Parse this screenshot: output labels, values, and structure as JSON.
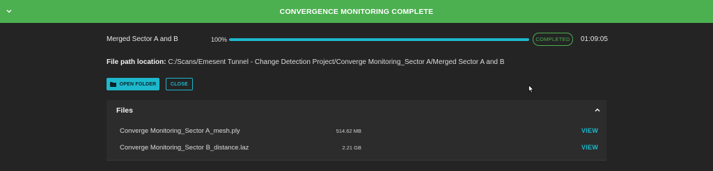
{
  "banner": {
    "title": "CONVERGENCE MONITORING COMPLETE",
    "chevron_icon": "chevron-down-icon",
    "color": "#4caf50"
  },
  "job": {
    "name": "Merged Sector A and B",
    "progress_text": "100%",
    "progress_value": 1.0,
    "status": "COMPLETED",
    "elapsed": "01:09:05"
  },
  "path": {
    "label": "File path location:",
    "value": "C:/Scans/Emesent Tunnel - Change Detection Project/Converge Monitoring_Sector A/Merged Sector A and B"
  },
  "actions": {
    "open_folder": "OPEN FOLDER",
    "open_folder_icon": "folder-icon",
    "close": "CLOSE"
  },
  "files": {
    "title": "Files",
    "collapse_icon": "chevron-up-icon",
    "items": [
      {
        "name": "Converge Monitoring_Sector A_mesh.ply",
        "size": "514.62 MB",
        "action": "VIEW"
      },
      {
        "name": "Converge Monitoring_Sector B_distance.laz",
        "size": "2.21 GB",
        "action": "VIEW"
      }
    ]
  },
  "colors": {
    "accent": "#1eb8cc",
    "success": "#4caf50",
    "background": "#242424",
    "panel": "#2c2c2c"
  }
}
